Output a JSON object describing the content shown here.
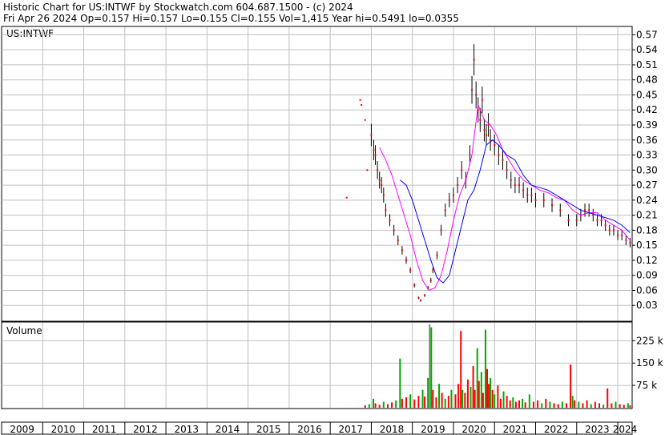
{
  "header": {
    "line1": "Historic Chart for US:INTWF by Stockwatch.com 604.687.1500 - (c) 2024",
    "line2": "Fri Apr 26 2024  Op=0.157  Hi=0.157  Lo=0.155  Cl=0.155  Vol=1,415  Year hi=0.5491  lo=0.0355"
  },
  "colors": {
    "background": "#ffffff",
    "grid": "#c0c0c0",
    "price_bar": "#000000",
    "price_dot": "#ff0000",
    "ma_short": "#ff00ff",
    "ma_long": "#0000ff",
    "volume_up": "#00aa00",
    "volume_down": "#ff0000",
    "volume_flat": "#888888"
  },
  "chart_data": [
    {
      "type": "line",
      "panel": "price",
      "label": "US:INTWF",
      "ylim": [
        0.0,
        0.585
      ],
      "y_ticks": [
        "0.57",
        "0.54",
        "0.51",
        "0.48",
        "0.45",
        "0.42",
        "0.39",
        "0.36",
        "0.33",
        "0.30",
        "0.27",
        "0.24",
        "0.21",
        "0.18",
        "0.15",
        "0.12",
        "0.09",
        "0.06",
        "0.03"
      ],
      "x_ticks": [
        "2009",
        "2010",
        "2011",
        "2012",
        "2013",
        "2014",
        "2015",
        "2016",
        "2017",
        "2018",
        "2019",
        "2020",
        "2021",
        "2022",
        "2023",
        "2024"
      ],
      "xlim": [
        2009.0,
        2024.35
      ],
      "grid": true,
      "series": [
        {
          "x": [
            2017.4,
            2017.73,
            2017.76,
            2017.85,
            2017.9,
            2018.0,
            2018.06,
            2018.1,
            2018.15,
            2018.2,
            2018.25,
            2018.3,
            2018.35,
            2018.45,
            2018.55,
            2018.65,
            2018.75,
            2018.85,
            2018.95,
            2019.05,
            2019.15,
            2019.2,
            2019.3,
            2019.38,
            2019.45,
            2019.5,
            2019.6,
            2019.7,
            2019.8,
            2019.9,
            2020.0,
            2020.1,
            2020.2,
            2020.3,
            2020.4,
            2020.45,
            2020.5,
            2020.55,
            2020.6,
            2020.65,
            2020.7,
            2020.75,
            2020.8,
            2020.85,
            2020.9,
            2021.0,
            2021.1,
            2021.2,
            2021.3,
            2021.4,
            2021.5,
            2021.6,
            2021.7,
            2021.8,
            2021.9,
            2022.0,
            2022.2,
            2022.4,
            2022.6,
            2022.8,
            2023.0,
            2023.1,
            2023.2,
            2023.3,
            2023.4,
            2023.5,
            2023.6,
            2023.7,
            2023.8,
            2023.9,
            2024.0,
            2024.1,
            2024.2,
            2024.3
          ],
          "close": [
            0.245,
            0.44,
            0.43,
            0.4,
            0.3,
            0.37,
            0.34,
            0.33,
            0.3,
            0.28,
            0.27,
            0.25,
            0.22,
            0.2,
            0.18,
            0.16,
            0.14,
            0.12,
            0.1,
            0.07,
            0.045,
            0.04,
            0.05,
            0.065,
            0.08,
            0.1,
            0.13,
            0.18,
            0.22,
            0.24,
            0.25,
            0.27,
            0.3,
            0.28,
            0.33,
            0.46,
            0.52,
            0.45,
            0.42,
            0.4,
            0.44,
            0.38,
            0.37,
            0.39,
            0.36,
            0.35,
            0.33,
            0.32,
            0.3,
            0.28,
            0.27,
            0.27,
            0.26,
            0.25,
            0.25,
            0.24,
            0.24,
            0.23,
            0.22,
            0.2,
            0.2,
            0.21,
            0.22,
            0.22,
            0.21,
            0.2,
            0.2,
            0.19,
            0.18,
            0.18,
            0.17,
            0.17,
            0.16,
            0.155
          ]
        },
        {
          "name": "",
          "x": [
            2018.2,
            2018.35,
            2018.5,
            2018.65,
            2018.8,
            2018.95,
            2019.1,
            2019.25,
            2019.4,
            2019.55,
            2019.7,
            2019.85,
            2020.0,
            2020.15,
            2020.3,
            2020.45,
            2020.6,
            2020.75,
            2020.9,
            2021.05,
            2021.2,
            2021.35,
            2021.5,
            2021.7,
            2021.9,
            2022.1,
            2022.3,
            2022.5,
            2022.7,
            2022.9,
            2023.1,
            2023.3,
            2023.5,
            2023.7,
            2023.9,
            2024.1,
            2024.3
          ],
          "values": [
            0.345,
            0.32,
            0.29,
            0.25,
            0.21,
            0.17,
            0.12,
            0.08,
            0.06,
            0.065,
            0.09,
            0.14,
            0.2,
            0.25,
            0.28,
            0.33,
            0.43,
            0.4,
            0.39,
            0.37,
            0.34,
            0.32,
            0.3,
            0.28,
            0.27,
            0.26,
            0.255,
            0.245,
            0.24,
            0.22,
            0.21,
            0.215,
            0.215,
            0.2,
            0.19,
            0.18,
            0.16
          ]
        },
        {
          "name": "",
          "x": [
            2018.7,
            2018.85,
            2019.0,
            2019.15,
            2019.3,
            2019.45,
            2019.6,
            2019.75,
            2019.9,
            2020.05,
            2020.2,
            2020.35,
            2020.5,
            2020.65,
            2020.8,
            2020.95,
            2021.1,
            2021.3,
            2021.5,
            2021.7,
            2021.9,
            2022.1,
            2022.3,
            2022.5,
            2022.7,
            2022.9,
            2023.1,
            2023.3,
            2023.5,
            2023.7,
            2023.9,
            2024.1,
            2024.3
          ],
          "values": [
            0.28,
            0.27,
            0.24,
            0.2,
            0.16,
            0.12,
            0.085,
            0.075,
            0.09,
            0.14,
            0.19,
            0.24,
            0.26,
            0.3,
            0.35,
            0.36,
            0.35,
            0.33,
            0.32,
            0.29,
            0.27,
            0.265,
            0.26,
            0.25,
            0.24,
            0.23,
            0.22,
            0.215,
            0.21,
            0.205,
            0.2,
            0.19,
            0.175
          ]
        }
      ]
    },
    {
      "type": "bar",
      "panel": "volume",
      "label": "Volume",
      "ylim": [
        0,
        285000
      ],
      "y_ticks": [
        "225 k",
        "150 k",
        "75 k"
      ],
      "bars": [
        {
          "x": 2017.85,
          "v": 8000,
          "c": "r"
        },
        {
          "x": 2017.95,
          "v": 12000,
          "c": "g"
        },
        {
          "x": 2018.05,
          "v": 30000,
          "c": "g"
        },
        {
          "x": 2018.1,
          "v": 15000,
          "c": "r"
        },
        {
          "x": 2018.2,
          "v": 10000,
          "c": "r"
        },
        {
          "x": 2018.3,
          "v": 20000,
          "c": "g"
        },
        {
          "x": 2018.4,
          "v": 12000,
          "c": "r"
        },
        {
          "x": 2018.5,
          "v": 18000,
          "c": "r"
        },
        {
          "x": 2018.6,
          "v": 25000,
          "c": "g"
        },
        {
          "x": 2018.7,
          "v": 165000,
          "c": "g"
        },
        {
          "x": 2018.75,
          "v": 30000,
          "c": "r"
        },
        {
          "x": 2018.85,
          "v": 35000,
          "c": "r"
        },
        {
          "x": 2018.95,
          "v": 45000,
          "c": "g"
        },
        {
          "x": 2019.05,
          "v": 28000,
          "c": "r"
        },
        {
          "x": 2019.15,
          "v": 40000,
          "c": "r"
        },
        {
          "x": 2019.25,
          "v": 60000,
          "c": "g"
        },
        {
          "x": 2019.3,
          "v": 38000,
          "c": "r"
        },
        {
          "x": 2019.38,
          "v": 100000,
          "c": "g"
        },
        {
          "x": 2019.42,
          "v": 280000,
          "c": "x"
        },
        {
          "x": 2019.46,
          "v": 270000,
          "c": "g"
        },
        {
          "x": 2019.5,
          "v": 60000,
          "c": "r"
        },
        {
          "x": 2019.58,
          "v": 35000,
          "c": "r"
        },
        {
          "x": 2019.65,
          "v": 80000,
          "c": "g"
        },
        {
          "x": 2019.72,
          "v": 50000,
          "c": "r"
        },
        {
          "x": 2019.8,
          "v": 30000,
          "c": "g"
        },
        {
          "x": 2019.88,
          "v": 40000,
          "c": "r"
        },
        {
          "x": 2019.95,
          "v": 60000,
          "c": "g"
        },
        {
          "x": 2020.05,
          "v": 45000,
          "c": "r"
        },
        {
          "x": 2020.12,
          "v": 80000,
          "c": "r"
        },
        {
          "x": 2020.18,
          "v": 258000,
          "c": "r"
        },
        {
          "x": 2020.22,
          "v": 60000,
          "c": "g"
        },
        {
          "x": 2020.28,
          "v": 50000,
          "c": "r"
        },
        {
          "x": 2020.35,
          "v": 95000,
          "c": "r"
        },
        {
          "x": 2020.42,
          "v": 70000,
          "c": "g"
        },
        {
          "x": 2020.48,
          "v": 140000,
          "c": "r"
        },
        {
          "x": 2020.52,
          "v": 60000,
          "c": "r"
        },
        {
          "x": 2020.58,
          "v": 200000,
          "c": "g"
        },
        {
          "x": 2020.62,
          "v": 90000,
          "c": "r"
        },
        {
          "x": 2020.68,
          "v": 120000,
          "c": "g"
        },
        {
          "x": 2020.72,
          "v": 50000,
          "c": "r"
        },
        {
          "x": 2020.78,
          "v": 262000,
          "c": "g"
        },
        {
          "x": 2020.82,
          "v": 130000,
          "c": "r"
        },
        {
          "x": 2020.86,
          "v": 80000,
          "c": "r"
        },
        {
          "x": 2020.9,
          "v": 100000,
          "c": "g"
        },
        {
          "x": 2020.95,
          "v": 60000,
          "c": "r"
        },
        {
          "x": 2021.0,
          "v": 45000,
          "c": "g"
        },
        {
          "x": 2021.08,
          "v": 75000,
          "c": "r"
        },
        {
          "x": 2021.15,
          "v": 30000,
          "c": "r"
        },
        {
          "x": 2021.22,
          "v": 55000,
          "c": "g"
        },
        {
          "x": 2021.3,
          "v": 40000,
          "c": "r"
        },
        {
          "x": 2021.38,
          "v": 25000,
          "c": "r"
        },
        {
          "x": 2021.45,
          "v": 35000,
          "c": "g"
        },
        {
          "x": 2021.52,
          "v": 20000,
          "c": "r"
        },
        {
          "x": 2021.6,
          "v": 25000,
          "c": "r"
        },
        {
          "x": 2021.68,
          "v": 30000,
          "c": "g"
        },
        {
          "x": 2021.75,
          "v": 18000,
          "c": "r"
        },
        {
          "x": 2021.85,
          "v": 45000,
          "c": "g"
        },
        {
          "x": 2021.95,
          "v": 20000,
          "c": "r"
        },
        {
          "x": 2022.05,
          "v": 25000,
          "c": "r"
        },
        {
          "x": 2022.15,
          "v": 15000,
          "c": "g"
        },
        {
          "x": 2022.25,
          "v": 30000,
          "c": "r"
        },
        {
          "x": 2022.35,
          "v": 20000,
          "c": "g"
        },
        {
          "x": 2022.45,
          "v": 15000,
          "c": "r"
        },
        {
          "x": 2022.55,
          "v": 12000,
          "c": "r"
        },
        {
          "x": 2022.65,
          "v": 20000,
          "c": "g"
        },
        {
          "x": 2022.75,
          "v": 15000,
          "c": "r"
        },
        {
          "x": 2022.85,
          "v": 145000,
          "c": "r"
        },
        {
          "x": 2022.9,
          "v": 40000,
          "c": "g"
        },
        {
          "x": 2022.95,
          "v": 25000,
          "c": "r"
        },
        {
          "x": 2023.05,
          "v": 20000,
          "c": "g"
        },
        {
          "x": 2023.15,
          "v": 15000,
          "c": "r"
        },
        {
          "x": 2023.25,
          "v": 25000,
          "c": "r"
        },
        {
          "x": 2023.35,
          "v": 12000,
          "c": "g"
        },
        {
          "x": 2023.45,
          "v": 20000,
          "c": "r"
        },
        {
          "x": 2023.55,
          "v": 15000,
          "c": "r"
        },
        {
          "x": 2023.65,
          "v": 10000,
          "c": "g"
        },
        {
          "x": 2023.75,
          "v": 65000,
          "c": "r"
        },
        {
          "x": 2023.85,
          "v": 15000,
          "c": "r"
        },
        {
          "x": 2023.95,
          "v": 20000,
          "c": "g"
        },
        {
          "x": 2024.05,
          "v": 12000,
          "c": "r"
        },
        {
          "x": 2024.15,
          "v": 10000,
          "c": "r"
        },
        {
          "x": 2024.25,
          "v": 15000,
          "c": "g"
        },
        {
          "x": 2024.3,
          "v": 8000,
          "c": "r"
        }
      ]
    }
  ]
}
